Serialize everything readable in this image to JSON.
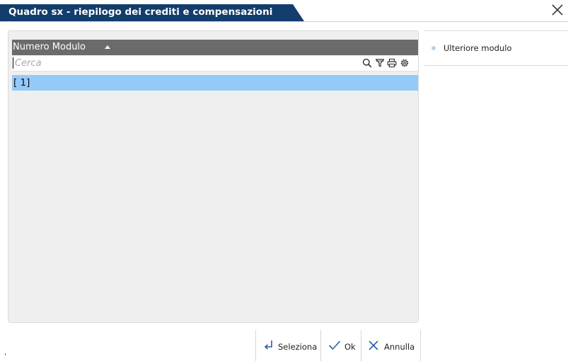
{
  "window": {
    "title": "Quadro sx - riepilogo dei crediti e compensazioni",
    "close_icon": "close-icon"
  },
  "grid": {
    "column_header": "Numero Modulo",
    "sort": "ascending",
    "search_placeholder": "Cerca",
    "tools": [
      "search-icon",
      "filter-icon",
      "print-icon",
      "settings-icon"
    ],
    "rows": [
      {
        "label": "[ 1]",
        "selected": true
      }
    ]
  },
  "side_panel": {
    "items": [
      {
        "label": "Ulteriore modulo"
      }
    ]
  },
  "buttons": {
    "seleziona": "Seleziona",
    "ok": "Ok",
    "annulla": "Annulla"
  },
  "colors": {
    "title_bg": "#123d6c",
    "header_bg": "#6b6b6b",
    "selected_row": "#94caf8",
    "panel_bg": "#efefef",
    "bullet": "#b4d3ee"
  }
}
